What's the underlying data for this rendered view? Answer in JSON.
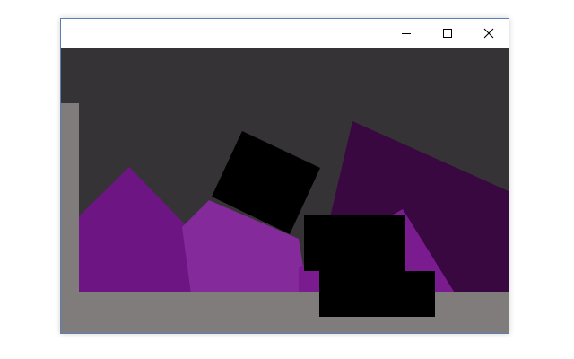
{
  "window": {
    "title": "",
    "controls": {
      "minimize_icon": "minimize-icon",
      "maximize_icon": "maximize-icon",
      "close_icon": "close-icon"
    }
  },
  "scene": {
    "colors": {
      "background": "#353336",
      "ground": "#7f7c7b",
      "wall": "#7f7c7b",
      "purple_dark": "#3a0840",
      "purple": "#6e1584",
      "purple_light": "#842a9b",
      "purple_mid": "#7a1c8f",
      "black_box": "#000000"
    }
  }
}
